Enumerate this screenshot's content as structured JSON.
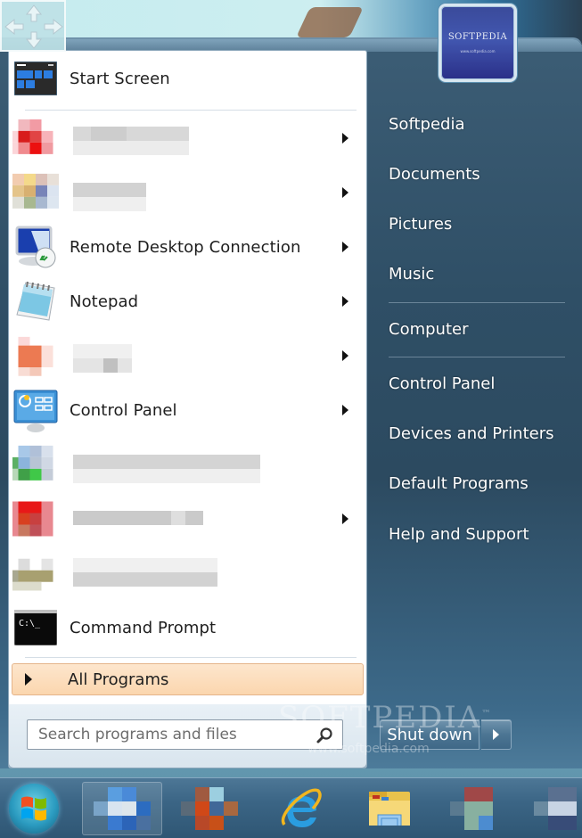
{
  "start_menu": {
    "pinned": [
      {
        "label": "Start Screen",
        "icon": "start-screen-icon",
        "has_submenu": false
      },
      {
        "label": "",
        "icon": "pixelated-app-icon",
        "has_submenu": true,
        "redacted": true
      },
      {
        "label": "",
        "icon": "pixelated-app-icon",
        "has_submenu": true,
        "redacted": true
      },
      {
        "label": "Remote Desktop Connection",
        "icon": "remote-desktop-icon",
        "has_submenu": true
      },
      {
        "label": "Notepad",
        "icon": "notepad-icon",
        "has_submenu": true
      },
      {
        "label": "",
        "icon": "pixelated-app-icon",
        "has_submenu": true,
        "redacted": true
      },
      {
        "label": "Control Panel",
        "icon": "control-panel-icon",
        "has_submenu": true
      },
      {
        "label": "",
        "icon": "pixelated-app-icon",
        "has_submenu": false,
        "redacted": true
      },
      {
        "label": "",
        "icon": "pixelated-app-icon",
        "has_submenu": true,
        "redacted": true
      },
      {
        "label": "",
        "icon": "pixelated-app-icon",
        "has_submenu": false,
        "redacted": true
      },
      {
        "label": "Command Prompt",
        "icon": "command-prompt-icon",
        "has_submenu": false
      }
    ],
    "all_programs_label": "All Programs",
    "search": {
      "placeholder": "Search programs and files",
      "value": ""
    },
    "user_tile": {
      "brand": "SOFTPEDIA",
      "trademark": "™",
      "url": "www.softpedia.com"
    },
    "right_pane": {
      "items": [
        "Softpedia",
        "Documents",
        "Pictures",
        "Music",
        "Computer",
        "Control Panel",
        "Devices and Printers",
        "Default Programs",
        "Help and Support"
      ]
    },
    "shutdown": {
      "label": "Shut down",
      "options_icon": "chevron-right-icon"
    }
  },
  "watermark": {
    "text": "SOFTPEDIA",
    "tm": "™",
    "url": "www.softpedia.com"
  },
  "taskbar": {
    "items": [
      {
        "name": "start-orb",
        "icon": "windows-logo-icon"
      },
      {
        "name": "taskbar-app-1",
        "icon": "pixelated-app-icon",
        "active": true
      },
      {
        "name": "taskbar-app-2",
        "icon": "pixelated-app-icon"
      },
      {
        "name": "taskbar-internet-explorer",
        "icon": "internet-explorer-icon"
      },
      {
        "name": "taskbar-file-explorer",
        "icon": "folder-icon"
      },
      {
        "name": "taskbar-app-5",
        "icon": "pixelated-app-icon"
      },
      {
        "name": "taskbar-app-6",
        "icon": "pixelated-app-icon"
      }
    ]
  },
  "colors": {
    "all_programs_highlight": "#fbd6ae",
    "menu_frame": "#2f4f66",
    "taskbar": "#3b6585"
  }
}
